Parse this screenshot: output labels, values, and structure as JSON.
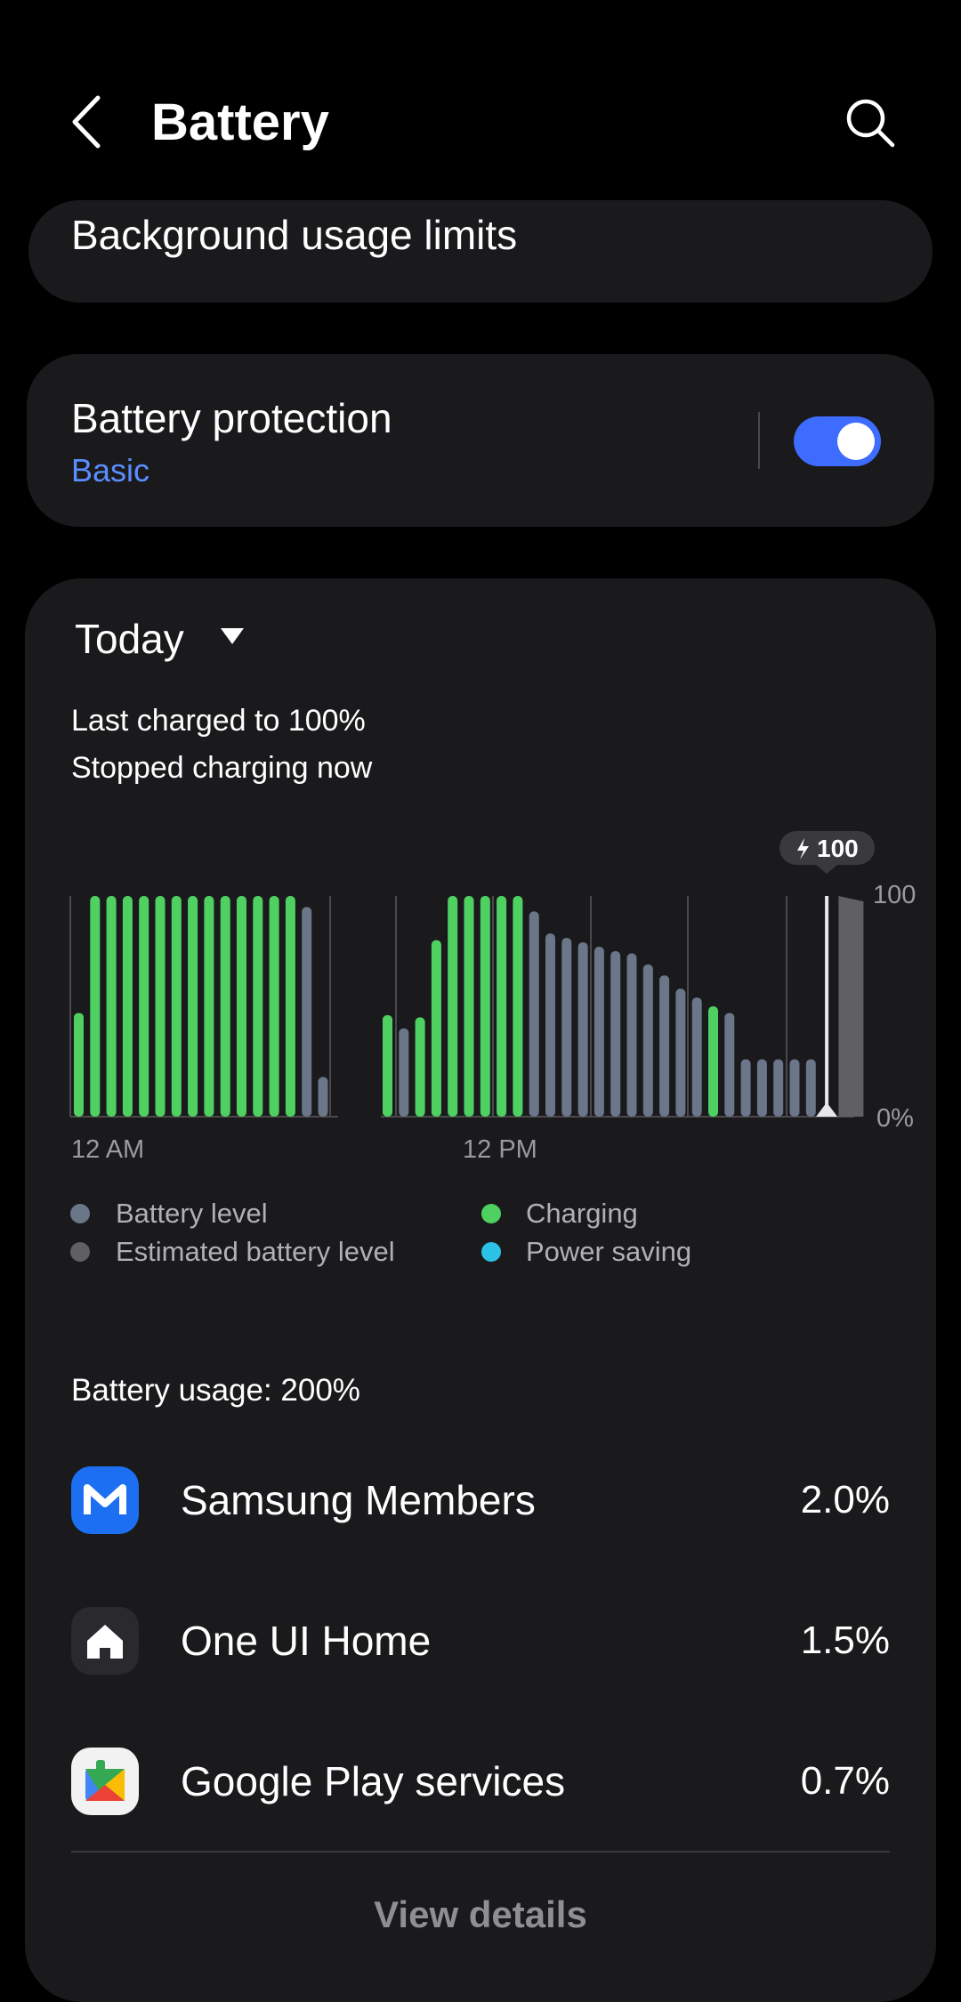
{
  "header": {
    "title": "Battery",
    "back_icon": "chevron-left-icon",
    "search_icon": "search-icon"
  },
  "background_limits": {
    "label": "Background usage limits"
  },
  "battery_protection": {
    "title": "Battery protection",
    "mode": "Basic",
    "enabled": true,
    "accent": "#3d6cff",
    "mode_color": "#5a8dff"
  },
  "usage": {
    "period": "Today",
    "last_charged": "Last charged to 100%",
    "charging_status": "Stopped charging now",
    "total": "Battery usage: 200%",
    "apps": [
      {
        "name": "Samsung Members",
        "percent": "2.0%",
        "icon": "samsung-members-icon"
      },
      {
        "name": "One UI Home",
        "percent": "1.5%",
        "icon": "home-icon"
      },
      {
        "name": "Google Play services",
        "percent": "0.7%",
        "icon": "google-play-services-icon"
      }
    ],
    "view_details": "View details"
  },
  "legend": [
    {
      "label": "Battery level",
      "color": "#6b7689"
    },
    {
      "label": "Estimated battery level",
      "color": "#5f5f64"
    },
    {
      "label": "Charging",
      "color": "#4fd162"
    },
    {
      "label": "Power saving",
      "color": "#2bc2e6"
    }
  ],
  "chart_data": {
    "type": "bar",
    "x_tick_labels": [
      "12 AM",
      "12 PM"
    ],
    "y_tick_labels": [
      "100",
      "0%"
    ],
    "ylim": [
      0,
      100
    ],
    "current_marker": "100",
    "colors": {
      "battery": "#6b7689",
      "charging": "#4fd162",
      "estimated": "#5f5f64",
      "marker": "#e8e8ea"
    },
    "segments": [
      {
        "bars": [
          {
            "v": 47,
            "s": "charging"
          },
          {
            "v": 100,
            "s": "charging"
          },
          {
            "v": 100,
            "s": "charging"
          },
          {
            "v": 100,
            "s": "charging"
          },
          {
            "v": 100,
            "s": "charging"
          },
          {
            "v": 100,
            "s": "charging"
          },
          {
            "v": 100,
            "s": "charging"
          },
          {
            "v": 100,
            "s": "charging"
          },
          {
            "v": 100,
            "s": "charging"
          },
          {
            "v": 100,
            "s": "charging"
          },
          {
            "v": 100,
            "s": "charging"
          },
          {
            "v": 100,
            "s": "charging"
          },
          {
            "v": 100,
            "s": "charging"
          },
          {
            "v": 100,
            "s": "charging"
          },
          {
            "v": 95,
            "s": "battery"
          },
          {
            "v": 18,
            "s": "battery"
          }
        ]
      },
      {
        "bars": [
          {
            "v": 46,
            "s": "charging"
          },
          {
            "v": 40,
            "s": "battery"
          },
          {
            "v": 45,
            "s": "charging"
          },
          {
            "v": 80,
            "s": "charging"
          },
          {
            "v": 100,
            "s": "charging"
          },
          {
            "v": 100,
            "s": "charging"
          },
          {
            "v": 100,
            "s": "charging"
          },
          {
            "v": 100,
            "s": "charging"
          },
          {
            "v": 100,
            "s": "charging"
          },
          {
            "v": 93,
            "s": "battery"
          },
          {
            "v": 83,
            "s": "battery"
          },
          {
            "v": 81,
            "s": "battery"
          },
          {
            "v": 79,
            "s": "battery"
          },
          {
            "v": 77,
            "s": "battery"
          },
          {
            "v": 75,
            "s": "battery"
          },
          {
            "v": 74,
            "s": "battery"
          },
          {
            "v": 69,
            "s": "battery"
          },
          {
            "v": 64,
            "s": "battery"
          },
          {
            "v": 58,
            "s": "battery"
          },
          {
            "v": 54,
            "s": "battery"
          },
          {
            "v": 50,
            "s": "charging"
          },
          {
            "v": 47,
            "s": "battery"
          },
          {
            "v": 26,
            "s": "battery"
          },
          {
            "v": 26,
            "s": "battery"
          },
          {
            "v": 26,
            "s": "battery"
          },
          {
            "v": 26,
            "s": "battery"
          },
          {
            "v": 26,
            "s": "battery"
          },
          {
            "v": 100,
            "s": "marker"
          },
          {
            "v": 100,
            "s": "estimated"
          }
        ]
      }
    ]
  }
}
